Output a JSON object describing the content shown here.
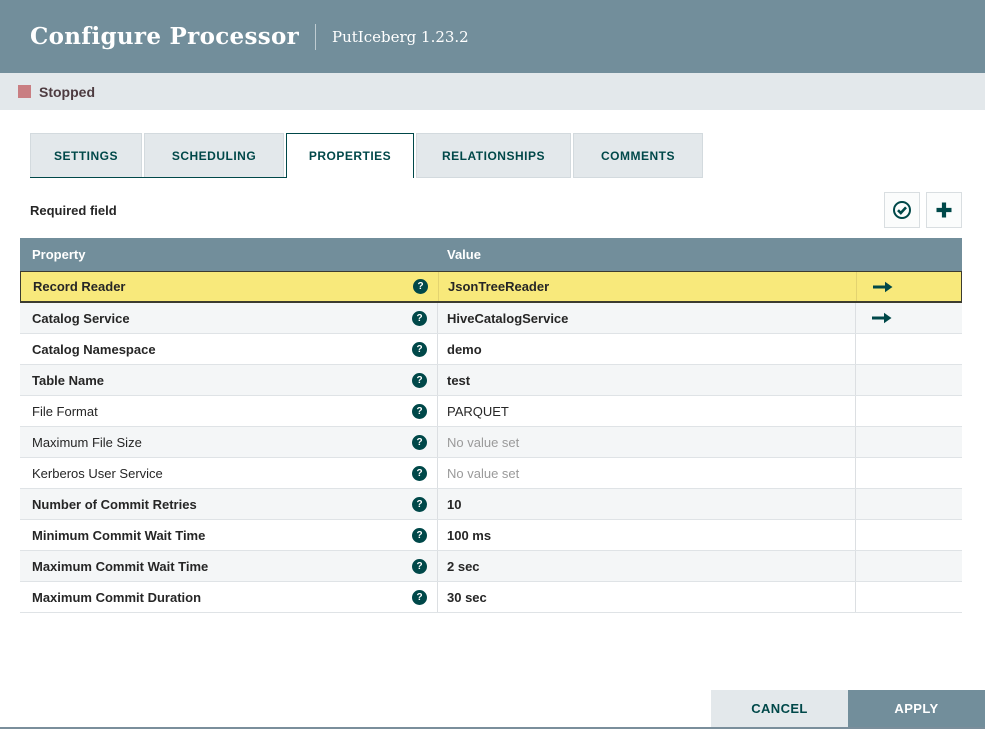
{
  "dialog": {
    "title": "Configure Processor",
    "subtitle": "PutIceberg 1.23.2"
  },
  "status": {
    "label": "Stopped"
  },
  "tabs": [
    {
      "label": "SETTINGS",
      "active": false
    },
    {
      "label": "SCHEDULING",
      "active": false
    },
    {
      "label": "PROPERTIES",
      "active": true
    },
    {
      "label": "RELATIONSHIPS",
      "active": false
    },
    {
      "label": "COMMENTS",
      "active": false
    }
  ],
  "properties": {
    "required_note": "Required field",
    "table": {
      "columns": [
        "Property",
        "Value"
      ],
      "rows": [
        {
          "property": "Record Reader",
          "value": "JsonTreeReader",
          "required": true,
          "empty": false,
          "has_goto": true,
          "highlighted": true
        },
        {
          "property": "Catalog Service",
          "value": "HiveCatalogService",
          "required": true,
          "empty": false,
          "has_goto": true,
          "highlighted": false
        },
        {
          "property": "Catalog Namespace",
          "value": "demo",
          "required": true,
          "empty": false,
          "has_goto": false,
          "highlighted": false
        },
        {
          "property": "Table Name",
          "value": "test",
          "required": true,
          "empty": false,
          "has_goto": false,
          "highlighted": false
        },
        {
          "property": "File Format",
          "value": "PARQUET",
          "required": false,
          "empty": false,
          "has_goto": false,
          "highlighted": false
        },
        {
          "property": "Maximum File Size",
          "value": "No value set",
          "required": false,
          "empty": true,
          "has_goto": false,
          "highlighted": false
        },
        {
          "property": "Kerberos User Service",
          "value": "No value set",
          "required": false,
          "empty": true,
          "has_goto": false,
          "highlighted": false
        },
        {
          "property": "Number of Commit Retries",
          "value": "10",
          "required": true,
          "empty": false,
          "has_goto": false,
          "highlighted": false
        },
        {
          "property": "Minimum Commit Wait Time",
          "value": "100 ms",
          "required": true,
          "empty": false,
          "has_goto": false,
          "highlighted": false
        },
        {
          "property": "Maximum Commit Wait Time",
          "value": "2 sec",
          "required": true,
          "empty": false,
          "has_goto": false,
          "highlighted": false
        },
        {
          "property": "Maximum Commit Duration",
          "value": "30 sec",
          "required": true,
          "empty": false,
          "has_goto": false,
          "highlighted": false
        }
      ]
    }
  },
  "footer": {
    "cancel": "CANCEL",
    "apply": "APPLY"
  },
  "icons": {
    "verify": "circle-check",
    "add": "plus",
    "help": "question-circle",
    "goto": "arrow-right",
    "stopped": "square"
  },
  "colors": {
    "accent_teal": "#004849",
    "header_slate": "#728E9B",
    "bar_gray": "#E3E8EB",
    "highlight_yellow": "#F8E97B",
    "stopped_red": "#C97E82",
    "empty_text": "#9a9a9a"
  }
}
